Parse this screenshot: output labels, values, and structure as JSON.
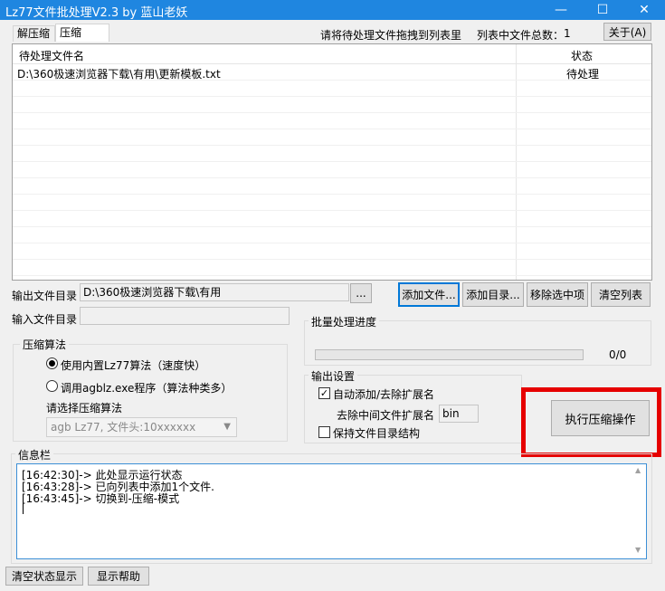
{
  "window": {
    "title": "Lz77文件批处理V2.3 by 蓝山老妖",
    "minimize": "—",
    "maximize": "☐",
    "close": "✕"
  },
  "tabs": [
    {
      "label": "解压缩",
      "active": false
    },
    {
      "label": "压缩",
      "active": true
    }
  ],
  "header": {
    "drag_hint": "请将待处理文件拖拽到列表里",
    "count_label": "列表中文件总数：",
    "count_value": "1",
    "about_label": "关于(A)"
  },
  "file_list": {
    "columns": [
      "待处理文件名",
      "状态"
    ],
    "rows": [
      {
        "name": "D:\\360极速浏览器下载\\有用\\更新模板.txt",
        "status": "待处理"
      }
    ]
  },
  "output_dir": {
    "label": "输出文件目录",
    "value": "D:\\360极速浏览器下载\\有用",
    "browse": "..."
  },
  "input_dir": {
    "label": "输入文件目录",
    "value": ""
  },
  "buttons": {
    "add_file": "添加文件...",
    "add_dir": "添加目录...",
    "remove_selected": "移除选中项",
    "clear_list": "清空列表",
    "execute": "执行压缩操作",
    "clear_status": "清空状态显示",
    "show_help": "显示帮助"
  },
  "compression": {
    "group_title": "压缩算法",
    "option_builtin": "使用内置Lz77算法（速度快）",
    "option_external": "调用agblz.exe程序（算法种类多）",
    "select_label": "请选择压缩算法",
    "select_value": "agb Lz77, 文件头:10xxxxxx",
    "selected_option": "builtin"
  },
  "progress": {
    "group_title": "批量处理进度",
    "text": "0/0",
    "fraction": 0
  },
  "output_settings": {
    "group_title": "输出设置",
    "auto_ext_label": "自动添加/去除扩展名",
    "auto_ext_checked": true,
    "strip_ext_label": "去除中间文件扩展名",
    "strip_ext_value": "bin",
    "keep_structure_label": "保持文件目录结构",
    "keep_structure_checked": false
  },
  "info": {
    "group_title": "信息栏",
    "lines": [
      "[16:42:30]-> 此处显示运行状态",
      "[16:43:28]-> 已向列表中添加1个文件.",
      "[16:43:45]-> 切换到-压缩-模式"
    ]
  },
  "colors": {
    "titlebar": "#1f86e0",
    "highlight_box": "#e60000",
    "focus_border": "#0078d7"
  }
}
